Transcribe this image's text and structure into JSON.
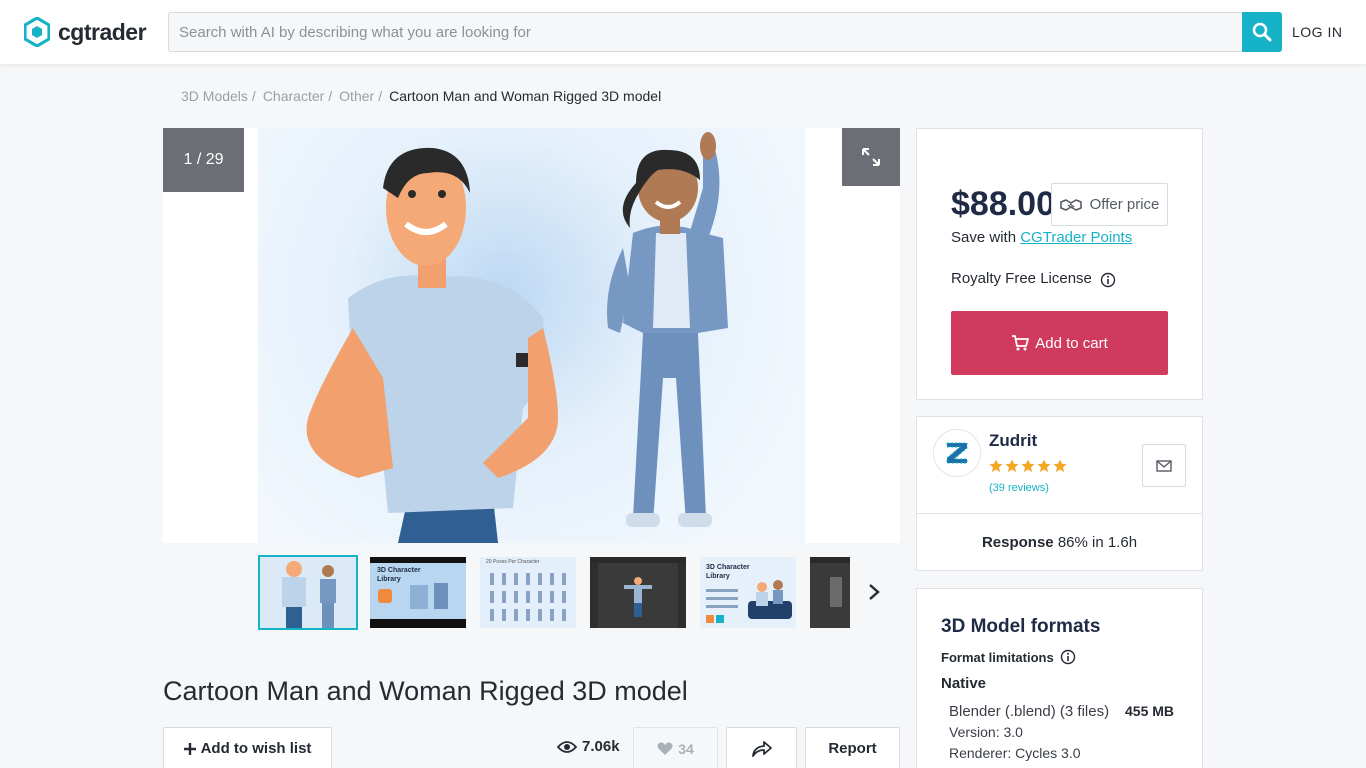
{
  "header": {
    "logo_text": "cgtrader",
    "search_placeholder": "Search with AI by describing what you are looking for",
    "login_label": "LOG IN"
  },
  "breadcrumb": {
    "items": [
      "3D Models",
      "Character",
      "Other"
    ],
    "separator": "/",
    "current": "Cartoon Man and Woman Rigged 3D model"
  },
  "gallery": {
    "counter": "1 / 29",
    "thumbnails": [
      {
        "name": "thumb-1",
        "caption": ""
      },
      {
        "name": "thumb-2",
        "caption": "3D Character Library"
      },
      {
        "name": "thumb-3",
        "caption": "20 Poses Per Character"
      },
      {
        "name": "thumb-4",
        "caption": ""
      },
      {
        "name": "thumb-5",
        "caption": "3D Character Library"
      },
      {
        "name": "thumb-6",
        "caption": ""
      }
    ]
  },
  "product": {
    "title": "Cartoon Man and Woman Rigged 3D model",
    "wish_label": "Add to wish list",
    "views": "7.06k",
    "likes": "34",
    "report_label": "Report"
  },
  "purchase": {
    "price": "$88.00",
    "offer_label": "Offer price",
    "save_prefix": "Save with",
    "save_link": "CGTrader Points",
    "license": "Royalty Free License",
    "cart_label": "Add to cart"
  },
  "seller": {
    "name": "Zudrit",
    "rating": 5,
    "reviews": "(39 reviews)",
    "response_label": "Response",
    "response_value": "86% in 1.6h"
  },
  "formats": {
    "title": "3D Model formats",
    "limitations_label": "Format limitations",
    "native_label": "Native",
    "file_name": "Blender (.blend) (3 files)",
    "file_size": "455 MB",
    "version": "Version: 3.0",
    "renderer": "Renderer: Cycles 3.0"
  },
  "colors": {
    "accent": "#16b3c8",
    "cart": "#d03b5d",
    "star": "#f5a623"
  }
}
